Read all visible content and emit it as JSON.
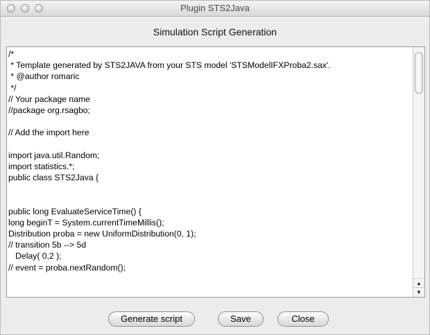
{
  "window": {
    "title": "Plugin STS2Java"
  },
  "panel": {
    "title": "Simulation Script Generation"
  },
  "editor": {
    "lines": [
      "/*",
      " * Template generated by STS2JAVA from your STS model 'STSModelIFXProba2.sax'.",
      " * @author romaric",
      " */",
      "// Your package name",
      "//package org.rsagbo;",
      "",
      "// Add the import here",
      "",
      "import java.util.Random;",
      "import statistics.*;",
      "public class STS2Java {",
      "",
      "",
      "public long EvaluateServiceTime() {",
      "long beginT = System.currentTimeMillis();",
      "Distribution proba = new UniformDistribution(0, 1);",
      "// transition 5b --> 5d",
      "   Delay( 0,2 );",
      "// event = proba.nextRandom();"
    ]
  },
  "icons": {
    "scroll_up": "scroll-up-arrow-icon",
    "scroll_down": "scroll-down-arrow-icon"
  },
  "buttons": {
    "generate": "Generate script",
    "save": "Save",
    "close": "Close"
  }
}
